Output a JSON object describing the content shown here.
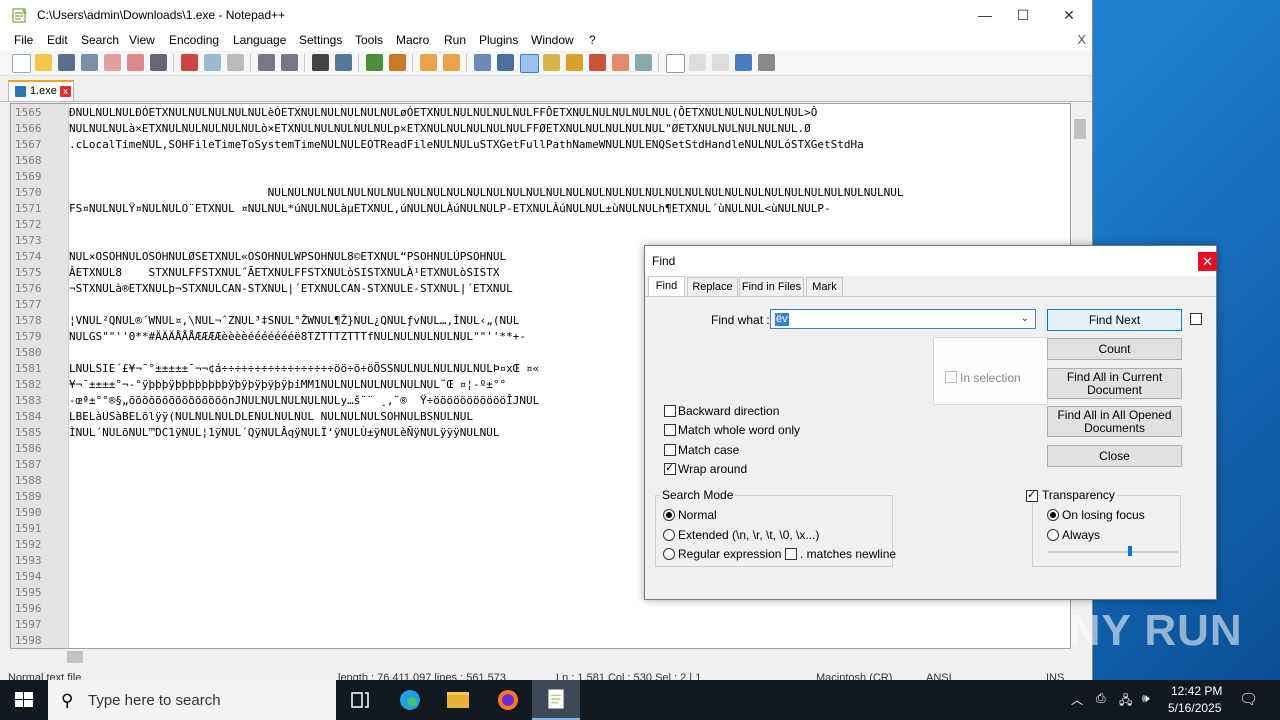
{
  "window": {
    "title": "C:\\Users\\admin\\Downloads\\1.exe - Notepad++",
    "minimize": "—",
    "maximize": "☐",
    "close": "✕"
  },
  "menu": {
    "items": [
      "File",
      "Edit",
      "Search",
      "View",
      "Encoding",
      "Language",
      "Settings",
      "Tools",
      "Macro",
      "Run",
      "Plugins",
      "Window",
      "?"
    ],
    "close_doc": "X"
  },
  "tab": {
    "label": "1.exe",
    "close": "x"
  },
  "editor": {
    "lines": [
      {
        "n": "1565",
        "text": "ÐNULNULNULÐÓETXNULNULNULNULNULèÓETXNULNULNULNULNULøÓETXNULNULNULNULNULFFÔETXNULNULNULNULNUL(ÔETXNULNULNULNULNUL>Ô"
      },
      {
        "n": "1566",
        "text": "NULNULNULà×ETXNULNULNULNULNULò×ETXNULNULNULNULNULp×ETXNULNULNULNULNULFFØETXNULNULNULNULNUL\"ØETXNULNULNULNULNUL.Ø"
      },
      {
        "n": "1567",
        "text": ".cLocalTimeNUL,SOHFileTimeToSystemTimeNULNULEOTReadFileNULNULuSTXGetFullPathNameWNULNULENQSetStdHandleNULNULóSTXGetStdHa"
      },
      {
        "n": "1568",
        "text": ""
      },
      {
        "n": "1569",
        "text": ""
      },
      {
        "n": "1570",
        "text": "                              NULNULNULNULNULNULNULNULNULNULNULNULNULNULNULNULNULNULNULNULNULNULNULNULNULNULNULNULNULNULNULNUL"
      },
      {
        "n": "1571",
        "text": "FS¤NULNULŸ¤NULNULO¨ETXNUL ¤NULNUL*úNULNULàµETXNUL,úNULNULÀúNULNULP-ETXNULÀúNULNUL±ùNULNULh¶ETXNUL´ùNULNUL<ùNULNULP-"
      },
      {
        "n": "1572",
        "text": ""
      },
      {
        "n": "1573",
        "text": ""
      },
      {
        "n": "1574",
        "text": "NUL×OSOHNULOSOHNULØSETXNUL«OSOHNULWPSOHNUL8©ETXNUL“PSOHNULÚPSOHNUL"
      },
      {
        "n": "1575",
        "text": "ÂETXNUL8    STXNULFFSTXNUL˝ÃETXNULFFSTXNULòSISTXNULÀ¹ETXNULòSISTX"
      },
      {
        "n": "1576",
        "text": "¬STXNULà®ETXNULþ¬STXNULCAN-STXNUL|´ETXNULCAN-STXNULE-STXNUL|´ETXNUL"
      },
      {
        "n": "1577",
        "text": ""
      },
      {
        "n": "1578",
        "text": "¦VNUL²QNUL®´WNUL¤,\\NUL¬ˆZNUL³‡SNUL°ŽWNUL¶Ž}NUL¿QNULƒvNUL…,ÌNUL‹„(NUL"
      },
      {
        "n": "1579",
        "text": "NULGS\"\"''0**#ÄÄÄÅÅÅÆÆÆÆèèèèéééééééë8TZTTTZTTTfNULNULNULNULNUL\"\"''**+-"
      },
      {
        "n": "1580",
        "text": ""
      },
      {
        "n": "1581",
        "text": "LNULSIE´£¥¬¯°±±±±±¯¬¬¢á÷÷÷÷÷÷÷÷÷÷÷÷÷÷÷÷÷öö÷ö÷öÖSSNULNULNULNULNULÞ¤xŒ ¤«"
      },
      {
        "n": "1582",
        "text": "¥¬¯±±±±°¬-°ÿþþþÿþþþþþþþþÿþÿþÿþÿþÿþiMM1NULNULNULNULNULNUL˜Œ ¤¦-º±°°"
      },
      {
        "n": "1583",
        "text": "-œª±°°®§„õõõõõõõõõõõõõõõnJNULNULNULNULNULy…š¨¨ ¸‚¨®  Ÿ÷öööööööööööÎJNUL"
      },
      {
        "n": "1584",
        "text": "LBELàUSàBELõlÿÿ(NULNULNULDLENULNULNUL NULNULNULSOHNULBSNULNUL"
      },
      {
        "n": "1585",
        "text": "ÌNUL´NULõNUL™DC1ÿNUL¦1ÿNUL´QÿNULÂqÿNULÏ‘ÿNULÙ±ÿNULèÑÿNULÿÿÿNULNUL"
      },
      {
        "n": "1586",
        "text": ""
      },
      {
        "n": "1587",
        "text": ""
      },
      {
        "n": "1588",
        "text": ""
      },
      {
        "n": "1589",
        "text": ""
      },
      {
        "n": "1590",
        "text": ""
      },
      {
        "n": "1591",
        "text": ""
      },
      {
        "n": "1592",
        "text": ""
      },
      {
        "n": "1593",
        "text": ""
      },
      {
        "n": "1594",
        "text": ""
      },
      {
        "n": "1595",
        "text": ""
      },
      {
        "n": "1596",
        "text": ""
      },
      {
        "n": "1597",
        "text": ""
      },
      {
        "n": "1598",
        "text": ""
      }
    ]
  },
  "status": {
    "type": "Normal text file",
    "length": "length : 76,411,097    lines : 561,573",
    "pos": "Ln : 1,581    Col : 530    Sel : 2 | 1",
    "eol": "Macintosh (CR)",
    "enc": "ANSI",
    "ins": "INS"
  },
  "find": {
    "title": "Find",
    "close": "✕",
    "tabs": [
      "Find",
      "Replace",
      "Find in Files",
      "Mark"
    ],
    "find_what_label": "Find what :",
    "find_what_value": "ëv",
    "buttons": {
      "find_next": "Find Next",
      "count": "Count",
      "find_all_current": "Find All in Current Document",
      "find_all_opened": "Find All in All Opened Documents",
      "close": "Close"
    },
    "in_selection": "In selection",
    "options": {
      "backward": "Backward direction",
      "whole_word": "Match whole word only",
      "match_case": "Match case",
      "wrap": "Wrap around"
    },
    "search_mode": {
      "label": "Search Mode",
      "normal": "Normal",
      "extended": "Extended (\\n, \\r, \\t, \\0, \\x...)",
      "regex": "Regular expression",
      "dot_newline": ". matches newline"
    },
    "transparency": {
      "label": "Transparency",
      "on_losing_focus": "On losing focus",
      "always": "Always",
      "level_percent": 63
    }
  },
  "taskbar": {
    "search_placeholder": "Type here to search",
    "time": "12:42 PM",
    "date": "5/16/2025"
  },
  "watermark": "ANY RUN"
}
